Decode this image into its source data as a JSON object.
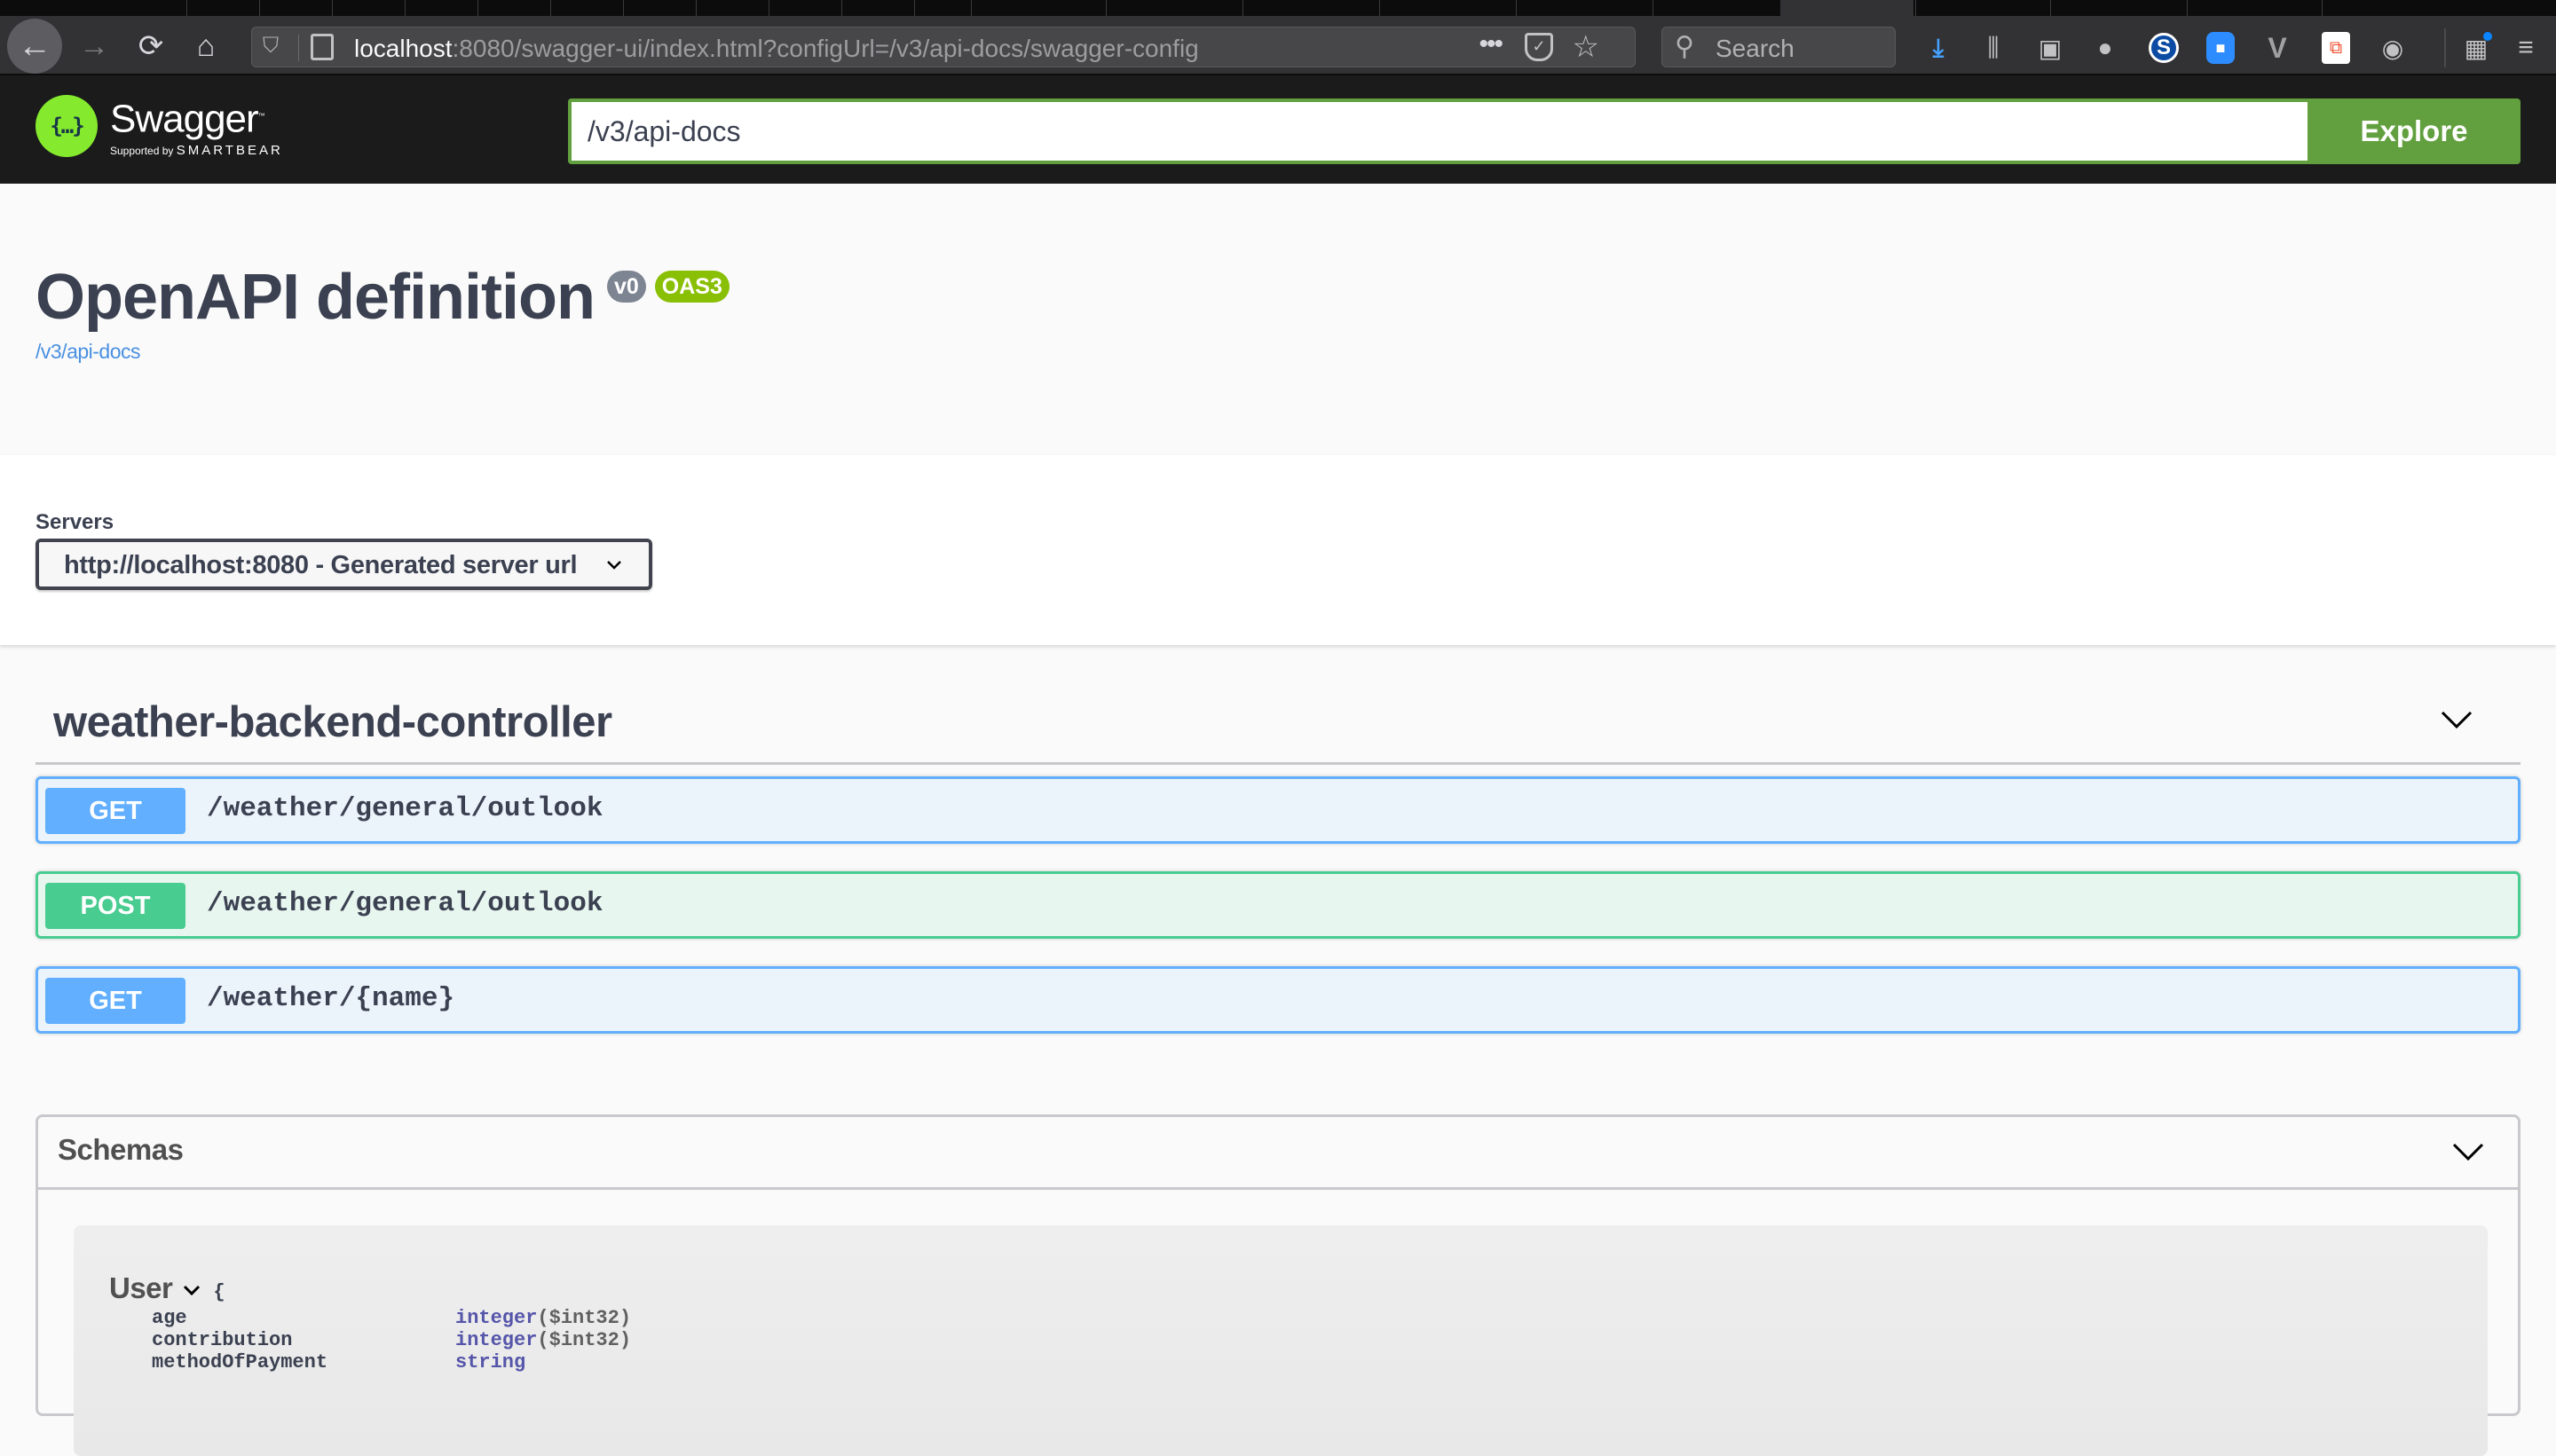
{
  "browser": {
    "url_host": "localhost",
    "url_rest": ":8080/swagger-ui/index.html?configUrl=/v3/api-docs/swagger-config",
    "search_placeholder": "Search",
    "icons": {
      "back": "←",
      "forward": "→",
      "reload": "⟳",
      "home": "⌂",
      "shield": "⛉",
      "more": "•••",
      "star": "☆",
      "search": "⚲",
      "download": "⤓",
      "library": "⫼",
      "sidebar": "▣",
      "extension_balls": "●",
      "s_ext": "S",
      "zoom_ext": "■",
      "vee_ext": "V",
      "tree_ext": "⧉",
      "account": "◉",
      "gift": "▦",
      "menu": "≡"
    }
  },
  "topbar": {
    "brand": "Swagger",
    "trademark": "™",
    "supported_by": "Supported by",
    "smartbear": "SMARTBEAR",
    "logo_glyph": "{…}",
    "spec_url": "/v3/api-docs",
    "explore_label": "Explore",
    "accent": "#62a03f"
  },
  "info": {
    "title": "OpenAPI definition",
    "version": "v0",
    "oas": "OAS3",
    "link": "/v3/api-docs"
  },
  "servers": {
    "label": "Servers",
    "selected": "http://localhost:8080 - Generated server url"
  },
  "tag": {
    "name": "weather-backend-controller",
    "operations": [
      {
        "method": "GET",
        "path": "/weather/general/outlook",
        "color": "#61affe"
      },
      {
        "method": "POST",
        "path": "/weather/general/outlook",
        "color": "#49cc90"
      },
      {
        "method": "GET",
        "path": "/weather/{name}",
        "color": "#61affe"
      }
    ]
  },
  "schemas": {
    "title": "Schemas",
    "models": [
      {
        "name": "User",
        "open_brace": "{",
        "properties": [
          {
            "name": "age",
            "type": "integer",
            "format": "($int32)"
          },
          {
            "name": "contribution",
            "type": "integer",
            "format": "($int32)"
          },
          {
            "name": "methodOfPayment",
            "type": "string",
            "format": ""
          }
        ]
      }
    ]
  }
}
